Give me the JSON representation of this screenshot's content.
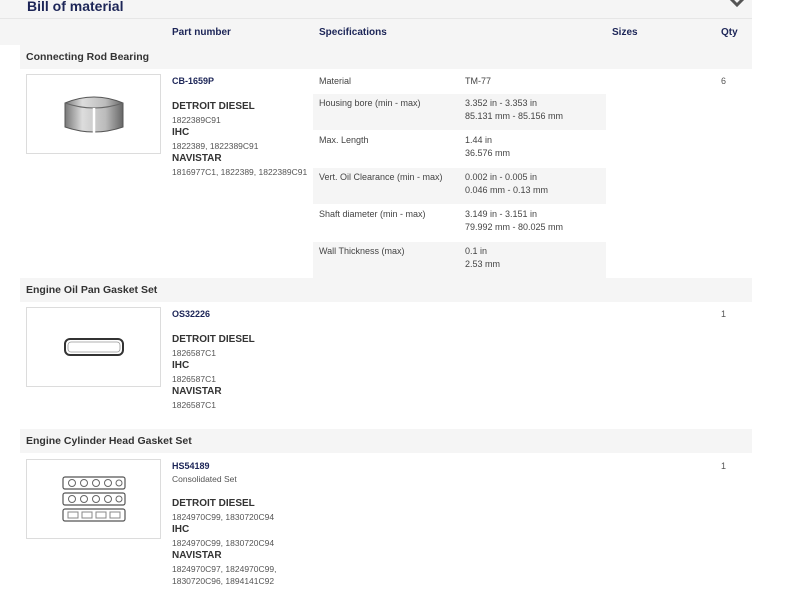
{
  "page": {
    "title": "Bill of material"
  },
  "columns": {
    "part_number": "Part number",
    "specifications": "Specifications",
    "sizes": "Sizes",
    "qty": "Qty"
  },
  "items": [
    {
      "section": "Connecting Rod Bearing",
      "image": "bearing-image",
      "part_number": "CB-1659P",
      "qty": "6",
      "xrefs": [
        {
          "brand": "DETROIT DIESEL",
          "refs": [
            "1822389C91"
          ]
        },
        {
          "brand": "IHC",
          "refs": [
            "1822389, 1822389C91"
          ]
        },
        {
          "brand": "NAVISTAR",
          "refs": [
            "1816977C1, 1822389, 1822389C91"
          ]
        }
      ],
      "specs": [
        {
          "label": "Material",
          "values": [
            "TM-77"
          ]
        },
        {
          "label": "Housing bore (min - max)",
          "values": [
            "3.352 in - 3.353 in",
            "85.131 mm - 85.156 mm"
          ]
        },
        {
          "label": "Max. Length",
          "values": [
            "1.44 in",
            "36.576 mm"
          ]
        },
        {
          "label": "Vert. Oil Clearance (min - max)",
          "values": [
            "0.002 in - 0.005 in",
            "0.046 mm - 0.13 mm"
          ]
        },
        {
          "label": "Shaft diameter (min - max)",
          "values": [
            "3.149 in - 3.151 in",
            "79.992 mm - 80.025 mm"
          ]
        },
        {
          "label": "Wall Thickness (max)",
          "values": [
            "0.1 in",
            "2.53 mm"
          ]
        }
      ]
    },
    {
      "section": "Engine Oil Pan Gasket Set",
      "image": "oil-pan-gasket-image",
      "part_number": "OS32226",
      "qty": "1",
      "xrefs": [
        {
          "brand": "DETROIT DIESEL",
          "refs": [
            "1826587C1"
          ]
        },
        {
          "brand": "IHC",
          "refs": [
            "1826587C1"
          ]
        },
        {
          "brand": "NAVISTAR",
          "refs": [
            "1826587C1"
          ]
        }
      ]
    },
    {
      "section": "Engine Cylinder Head Gasket Set",
      "image": "head-gasket-image",
      "part_number": "HS54189",
      "description": "Consolidated Set",
      "qty": "1",
      "xrefs": [
        {
          "brand": "DETROIT DIESEL",
          "refs": [
            "1824970C99, 1830720C94"
          ]
        },
        {
          "brand": "IHC",
          "refs": [
            "1824970C99, 1830720C94"
          ]
        },
        {
          "brand": "NAVISTAR",
          "refs": [
            "1824970C97, 1824970C99,",
            "1830720C96, 1894141C92"
          ]
        }
      ]
    }
  ]
}
